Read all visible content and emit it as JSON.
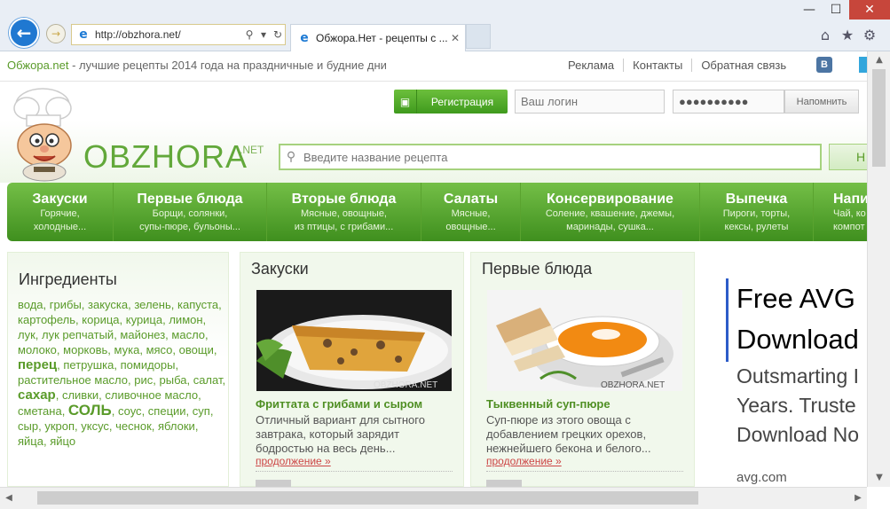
{
  "browser": {
    "url": "http://obzhora.net/",
    "tab_title": "Обжора.Нет - рецепты с ...",
    "window_controls": {
      "minimize": "—",
      "maximize": "☐",
      "close": "✕"
    },
    "tab_close": "✕"
  },
  "site": {
    "brand": "Обжора.net",
    "tagline": " - лучшие рецепты 2014 года на праздничные и будние дни",
    "top_links": [
      "Реклама",
      "Контакты",
      "Обратная связь"
    ],
    "vk_label": "В",
    "register_label": "Регистрация",
    "login_placeholder": "Ваш логин",
    "password_value": "●●●●●●●●●●",
    "remind_label": "Напомнить",
    "logo": "OBZHORA",
    "logo_sup": ".NET",
    "search_placeholder": "Введите название рецепта",
    "search_button": "Н"
  },
  "nav": [
    {
      "title": "Закуски",
      "sub1": "Горячие,",
      "sub2": "холодные..."
    },
    {
      "title": "Первые блюда",
      "sub1": "Борщи, солянки,",
      "sub2": "супы-пюре, бульоны..."
    },
    {
      "title": "Вторые блюда",
      "sub1": "Мясные, овощные,",
      "sub2": "из птицы, с грибами..."
    },
    {
      "title": "Салаты",
      "sub1": "Мясные,",
      "sub2": "овощные..."
    },
    {
      "title": "Консервирование",
      "sub1": "Соление, квашение, джемы,",
      "sub2": "маринады, сушка..."
    },
    {
      "title": "Выпечка",
      "sub1": "Пироги, торты,",
      "sub2": "кексы, рулеты"
    },
    {
      "title": "Напи",
      "sub1": "Чай, ко",
      "sub2": "компот"
    }
  ],
  "ingredients": {
    "heading": "Ингредиенты",
    "items": [
      {
        "t": "вода",
        "s": ""
      },
      {
        "t": "грибы",
        "s": ""
      },
      {
        "t": "закуска",
        "s": ""
      },
      {
        "t": "зелень",
        "s": ""
      },
      {
        "t": "капуста",
        "s": ""
      },
      {
        "t": "картофель",
        "s": ""
      },
      {
        "t": "корица",
        "s": ""
      },
      {
        "t": "курица",
        "s": ""
      },
      {
        "t": "лимон",
        "s": ""
      },
      {
        "t": "лук",
        "s": ""
      },
      {
        "t": "лук репчатый",
        "s": ""
      },
      {
        "t": "майонез",
        "s": ""
      },
      {
        "t": "масло",
        "s": ""
      },
      {
        "t": "молоко",
        "s": ""
      },
      {
        "t": "морковь",
        "s": ""
      },
      {
        "t": "мука",
        "s": ""
      },
      {
        "t": "мясо",
        "s": ""
      },
      {
        "t": "овощи",
        "s": ""
      },
      {
        "t": "перец",
        "s": "big"
      },
      {
        "t": "петрушка",
        "s": ""
      },
      {
        "t": "помидоры",
        "s": ""
      },
      {
        "t": "растительное масло",
        "s": ""
      },
      {
        "t": "рис",
        "s": ""
      },
      {
        "t": "рыба",
        "s": ""
      },
      {
        "t": "салат",
        "s": ""
      },
      {
        "t": "сахар",
        "s": "big"
      },
      {
        "t": "сливки",
        "s": ""
      },
      {
        "t": "сливочное масло",
        "s": ""
      },
      {
        "t": "сметана",
        "s": ""
      },
      {
        "t": "соль",
        "s": "huge"
      },
      {
        "t": "соус",
        "s": ""
      },
      {
        "t": "специи",
        "s": ""
      },
      {
        "t": "суп",
        "s": ""
      },
      {
        "t": "сыр",
        "s": ""
      },
      {
        "t": "укроп",
        "s": ""
      },
      {
        "t": "уксус",
        "s": ""
      },
      {
        "t": "чеснок",
        "s": ""
      },
      {
        "t": "яблоки",
        "s": ""
      },
      {
        "t": "яйца",
        "s": ""
      },
      {
        "t": "яйцо",
        "s": ""
      }
    ]
  },
  "columns": [
    {
      "heading": "Закуски",
      "recipe_title": "Фриттата с грибами и сыром",
      "desc": "Отличный вариант для сытного завтрака, который зарядит бодростью на весь день...",
      "more": "продолжение »",
      "watermark": "OBZHORA.NET"
    },
    {
      "heading": "Первые блюда",
      "recipe_title": "Тыквенный суп-пюре",
      "desc": "Суп-пюре из этого овоща с добавлением грецких орехов, нежнейшего бекона и белого...",
      "more": "продолжение »",
      "watermark": "OBZHORA.NET"
    }
  ],
  "ad": {
    "title1": "Free AVG",
    "title2": "Download",
    "desc1": "Outsmarting I",
    "desc2": "Years. Truste",
    "desc3": "Download No",
    "url": "avg.com"
  }
}
